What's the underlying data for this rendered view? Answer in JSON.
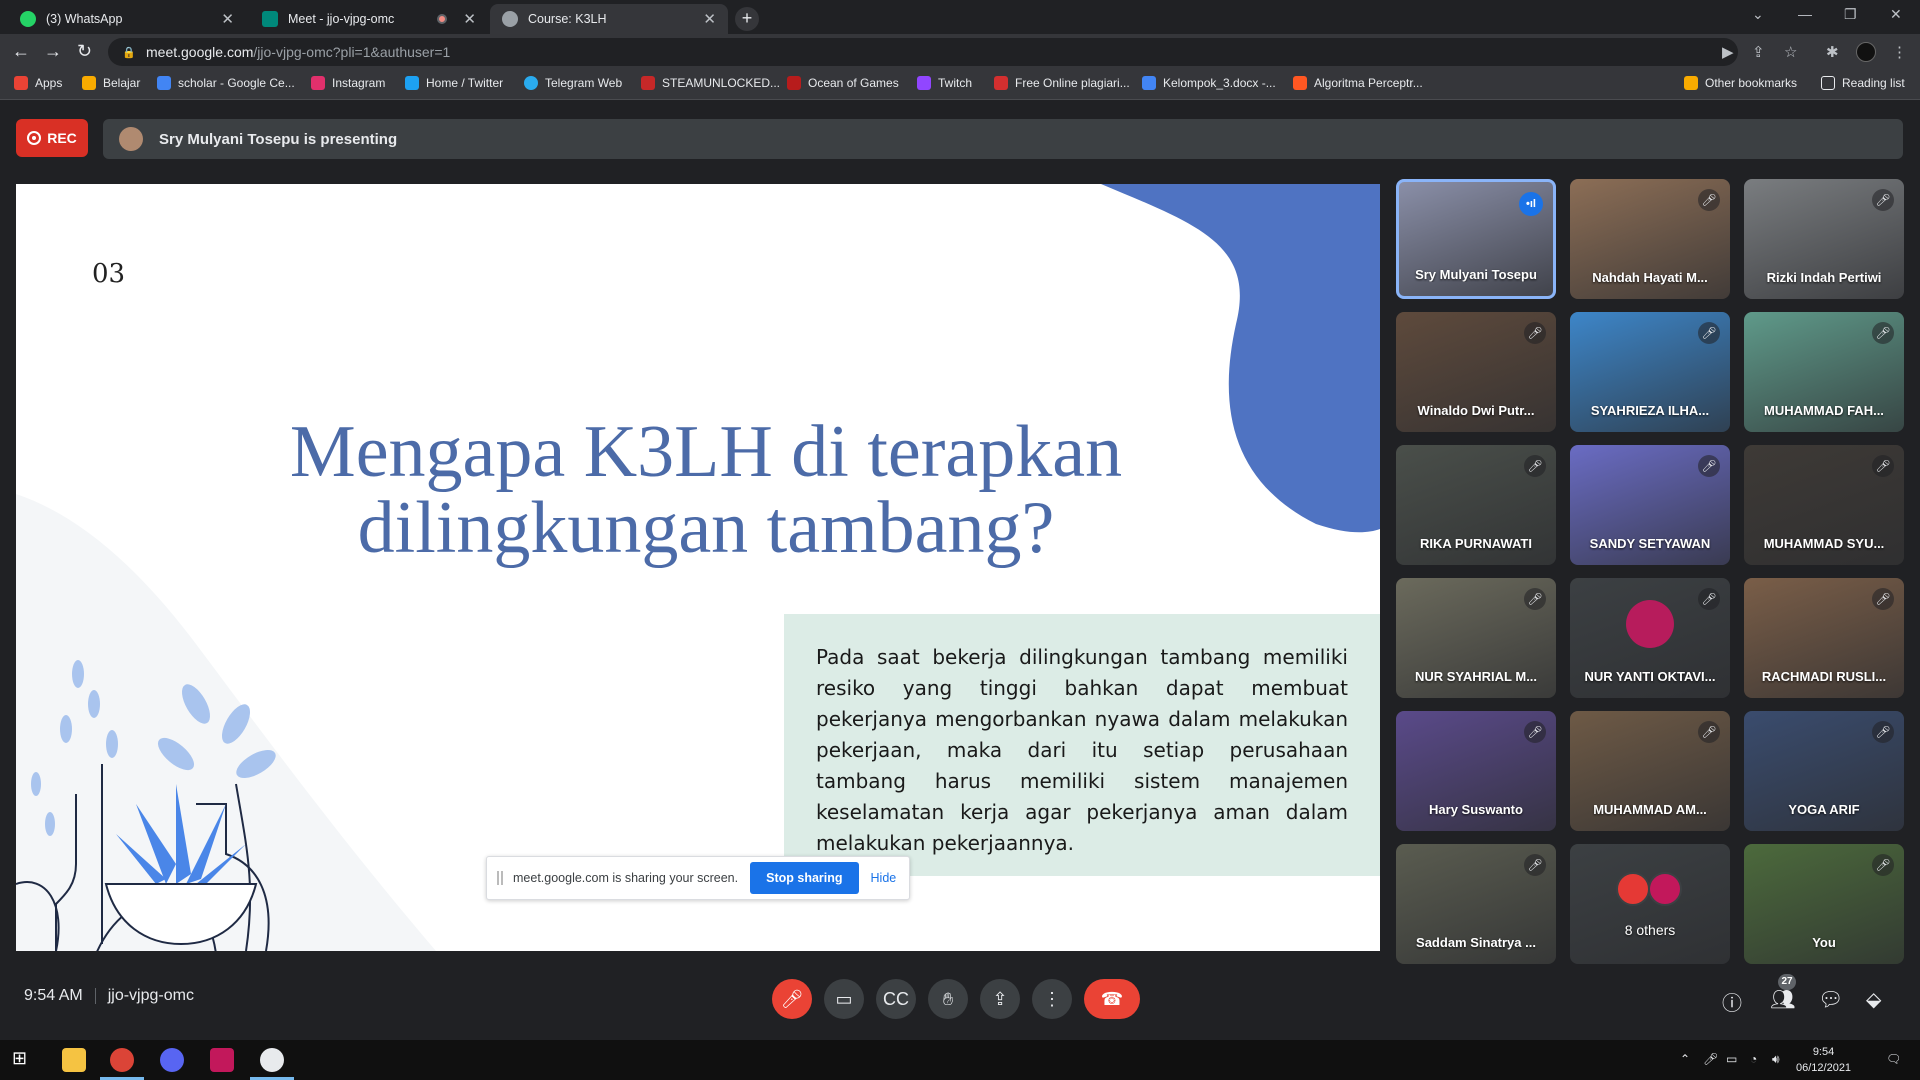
{
  "browser": {
    "tabs": [
      {
        "label": "(3) WhatsApp",
        "color": "#25d366"
      },
      {
        "label": "Meet - jjo-vjpg-omc",
        "color": "#00897b"
      },
      {
        "label": "Course: K3LH",
        "color": "#9aa0a6"
      }
    ],
    "url_host": "meet.google.com",
    "url_path": "/jjo-vjpg-omc?pli=1&authuser=1",
    "bookmarks": [
      {
        "label": "Apps",
        "color": "#ea4335"
      },
      {
        "label": "Belajar",
        "color": "#f9ab00"
      },
      {
        "label": "scholar - Google Ce...",
        "color": "#4285f4"
      },
      {
        "label": "Instagram",
        "color": "#e1306c"
      },
      {
        "label": "Home / Twitter",
        "color": "#1da1f2"
      },
      {
        "label": "Telegram Web",
        "color": "#2aabee"
      },
      {
        "label": "STEAMUNLOCKED...",
        "color": "#c62828"
      },
      {
        "label": "Ocean of Games",
        "color": "#b71c1c"
      },
      {
        "label": "Twitch",
        "color": "#9146ff"
      },
      {
        "label": "Free Online plagiari...",
        "color": "#d32f2f"
      },
      {
        "label": "Kelompok_3.docx -...",
        "color": "#4285f4"
      },
      {
        "label": "Algoritma Perceptr...",
        "color": "#ff5722"
      }
    ],
    "other_bookmarks": "Other bookmarks",
    "reading_list": "Reading list"
  },
  "meet": {
    "rec_label": "REC",
    "presenting_text": "Sry Mulyani Tosepu is presenting",
    "slide": {
      "number": "03",
      "title": "Mengapa K3LH di  terapkan dilingkungan tambang?",
      "body": "Pada saat bekerja dilingkungan tambang memiliki resiko yang tinggi bahkan dapat membuat pekerjanya mengorbankan nyawa dalam melakukan pekerjaan, maka dari itu setiap perusahaan tambang harus memiliki sistem manajemen keselamatan kerja agar pekerjanya aman dalam melakukan pekerjaannya."
    },
    "share_banner": {
      "text": "meet.google.com is sharing your screen.",
      "stop_label": "Stop sharing",
      "hide_label": "Hide"
    },
    "participants": [
      {
        "name": "Sry Mulyani Tosepu",
        "bg": "#8a8fa8",
        "speaking": true
      },
      {
        "name": "Nahdah Hayati M...",
        "bg": "#8c6e56"
      },
      {
        "name": "Rizki Indah Pertiwi",
        "bg": "#7a7d80"
      },
      {
        "name": "Winaldo Dwi Putr...",
        "bg": "#5e4a3c"
      },
      {
        "name": "SYAHRIEZA ILHA...",
        "bg": "#3d86c9"
      },
      {
        "name": "MUHAMMAD FAH...",
        "bg": "#5f9a8a"
      },
      {
        "name": "RIKA PURNAWATI",
        "bg": "#4a4f4a"
      },
      {
        "name": "SANDY SETYAWAN",
        "bg": "#6a6cc4"
      },
      {
        "name": "MUHAMMAD SYU...",
        "bg": "#3e3a36"
      },
      {
        "name": "NUR SYAHRIAL M...",
        "bg": "#6b6a5c"
      },
      {
        "name": "NUR YANTI OKTAVI...",
        "bg": "#3c4043",
        "avatar": "#b71c5c"
      },
      {
        "name": "RACHMADI RUSLI...",
        "bg": "#7a5e48"
      },
      {
        "name": "Hary Suswanto",
        "bg": "#5a4a8a"
      },
      {
        "name": "MUHAMMAD AM...",
        "bg": "#6e5a46"
      },
      {
        "name": "YOGA ARIF",
        "bg": "#3a4c6e"
      },
      {
        "name": "Saddam Sinatrya ...",
        "bg": "#5a5c50"
      },
      {
        "name": "8 others",
        "bg": "#3c4043",
        "others": true
      },
      {
        "name": "You",
        "bg": "#4c6a3c"
      }
    ],
    "time": "9:54 AM",
    "meeting_code": "jjo-vjpg-omc",
    "people_count": "27"
  },
  "taskbar": {
    "time": "9:54",
    "date": "06/12/2021"
  }
}
